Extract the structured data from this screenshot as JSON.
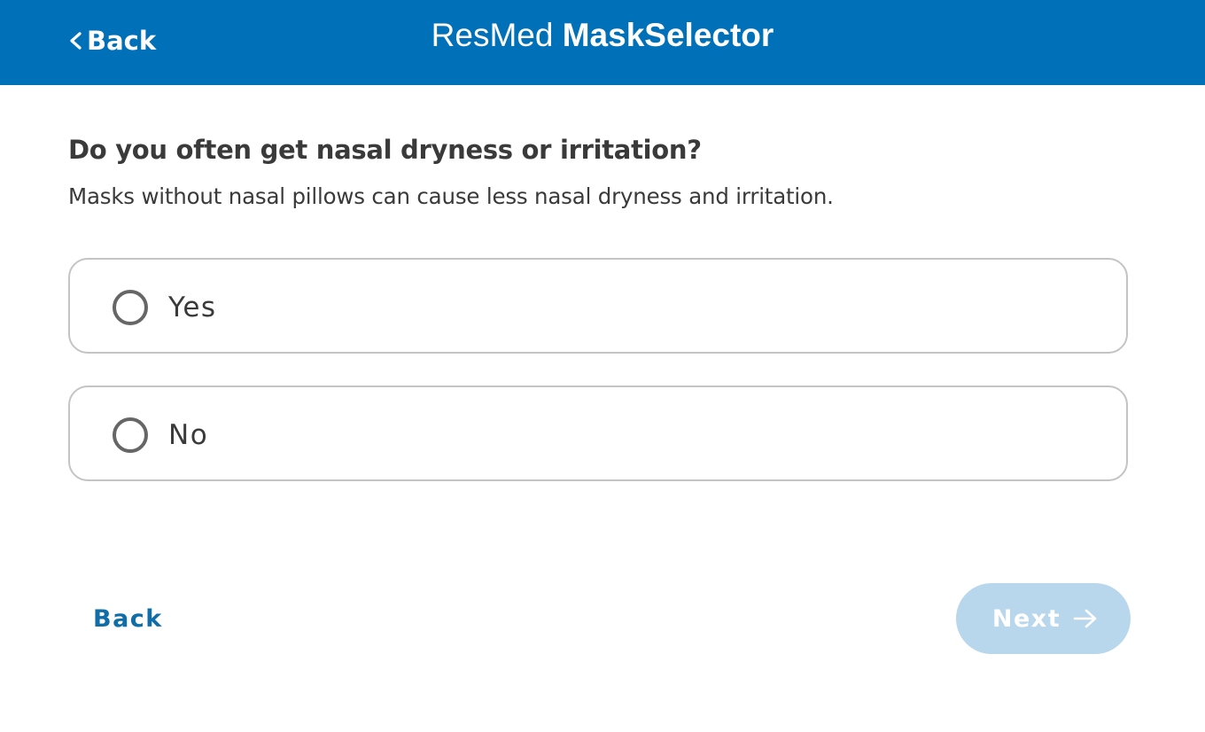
{
  "header": {
    "back_label": "Back",
    "back_icon": "chevron-left-icon",
    "brand": "ResMed",
    "product": "MaskSelector"
  },
  "question": {
    "title": "Do you often get nasal dryness or irritation?",
    "hint": "Masks without nasal pillows can cause less nasal dryness and irritation."
  },
  "options": [
    {
      "label": "Yes",
      "selected": false
    },
    {
      "label": "No",
      "selected": false
    }
  ],
  "footer": {
    "back_label": "Back",
    "next_label": "Next",
    "next_icon": "arrow-right-icon",
    "next_enabled": false
  },
  "colors": {
    "header_bg": "#0070b9",
    "link": "#0f6ea8",
    "next_disabled_bg": "#b8d6ec",
    "text": "#3a3a3a",
    "option_border": "#c4c4c4"
  }
}
